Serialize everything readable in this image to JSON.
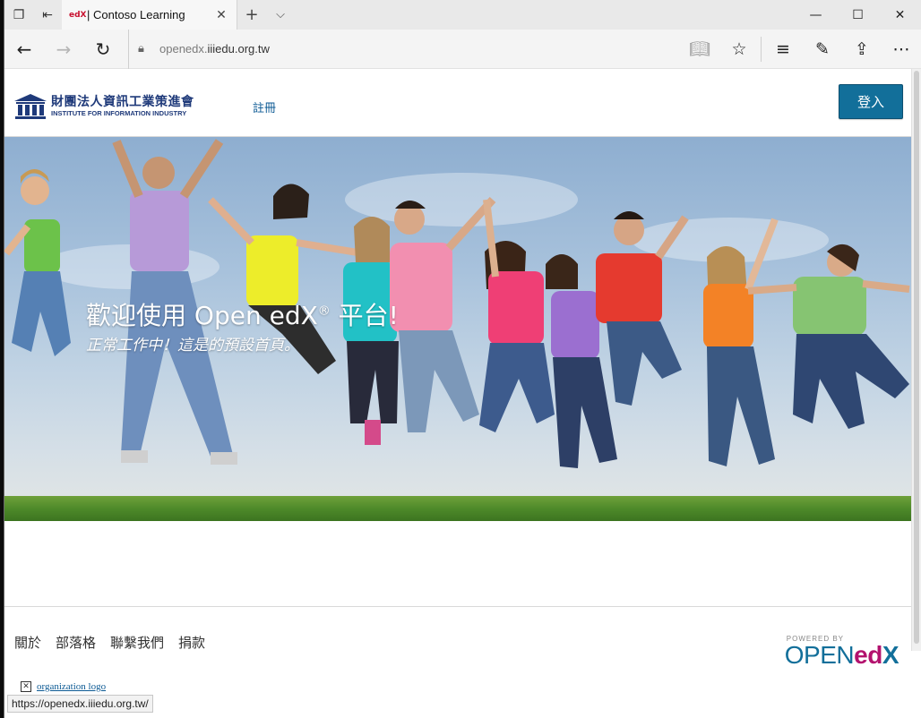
{
  "browser": {
    "tab_title": "| Contoso Learning",
    "favicon_text": "edX",
    "url_prefix": "openedx.",
    "url_domain": "iiiedu.org.tw",
    "status_url": "https://openedx.iiiedu.org.tw/"
  },
  "header": {
    "logo_zh": "財團法人資訊工業策進會",
    "logo_en": "INSTITUTE FOR INFORMATION INDUSTRY",
    "register_link": "註冊",
    "login_button": "登入"
  },
  "hero": {
    "title": "歡迎使用 Open edX",
    "title_mark": "®",
    "title_suffix": " 平台!",
    "subtitle": "正常工作中！這是的預設首頁。"
  },
  "footer": {
    "links": [
      "關於",
      "部落格",
      "聯繫我們",
      "捐款"
    ],
    "powered_by": "POWERED BY",
    "openedx_open": "OPEN",
    "openedx_ed": "ed",
    "openedx_x": "X",
    "org_logo_alt": "organization logo"
  },
  "colors": {
    "brand_blue": "#126f9a",
    "logo_navy": "#1f3a7a",
    "edx_magenta": "#b3126e"
  }
}
